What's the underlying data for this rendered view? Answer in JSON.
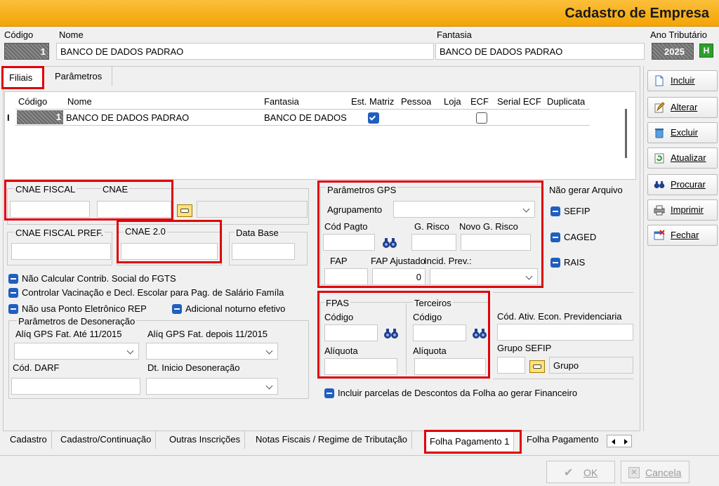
{
  "window": {
    "title": "Cadastro de Empresa"
  },
  "header": {
    "codigo_label": "Código",
    "codigo_value": "1",
    "nome_label": "Nome",
    "nome_value": "BANCO DE DADOS PADRAO",
    "fantasia_label": "Fantasia",
    "fantasia_value": "BANCO DE DADOS PADRAO",
    "ano_label": "Ano Tributário",
    "ano_value": "2025",
    "ano_btn": "H"
  },
  "tabs_top": [
    "Filiais",
    "Parâmetros"
  ],
  "grid": {
    "columns": [
      "Código",
      "Nome",
      "Fantasia",
      "Est. Matriz",
      "Pessoa",
      "Loja",
      "ECF",
      "Serial ECF",
      "Duplicata"
    ],
    "row": {
      "indicator": "I",
      "codigo": "1",
      "nome": "BANCO DE DADOS PADRAO",
      "fantasia": "BANCO DE DADOS PADRAO",
      "est_matriz": true,
      "ecf": false
    }
  },
  "side_buttons": [
    {
      "label": "Incluir",
      "icon": "new-doc-icon"
    },
    {
      "label": "Alterar",
      "icon": "edit-icon"
    },
    {
      "label": "Excluir",
      "icon": "trash-icon"
    },
    {
      "label": "Atualizar",
      "icon": "refresh-icon"
    },
    {
      "label": "Procurar",
      "icon": "binoculars-icon"
    },
    {
      "label": "Imprimir",
      "icon": "printer-icon"
    },
    {
      "label": "Fechar",
      "icon": "close-window-icon"
    }
  ],
  "form": {
    "cnae_fiscal": "CNAE FISCAL",
    "cnae": "CNAE",
    "cnae_fiscal_pref": "CNAE FISCAL PREF.",
    "cnae20": "CNAE 2.0",
    "data_base": "Data Base",
    "chk_fgts": "Não Calcular Contrib. Social do FGTS",
    "chk_vacinacao": "Controlar Vacinação e Decl. Escolar para Pag. de Salário Famíla",
    "chk_ponto": "Não usa Ponto Eletrônico REP",
    "chk_noturno": "Adicional noturno efetivo",
    "desoneracao": {
      "title": "Parâmetros de Desoneração",
      "aliq_ate": "Alíq GPS Fat. Até 11/2015",
      "aliq_depois": "Alíq GPS Fat. depois 11/2015",
      "cod_darf": "Cód. DARF",
      "dt_inicio": "Dt. Inicio Desoneração"
    },
    "gps": {
      "title": "Parâmetros GPS",
      "agrupamento": "Agrupamento",
      "cod_pagto": "Cód Pagto",
      "g_risco": "G. Risco",
      "novo_g_risco": "Novo G. Risco",
      "fap": "FAP",
      "fap_ajustado": "FAP Ajustado",
      "fap_ajustado_value": "0",
      "incid_prev": "Incid. Prev.:"
    },
    "nao_gerar": {
      "title": "Não gerar Arquivo",
      "sefip": "SEFIP",
      "caged": "CAGED",
      "rais": "RAIS"
    },
    "fpas": {
      "title": "FPAS",
      "codigo": "Código",
      "aliquota": "Alíquota"
    },
    "terceiros": {
      "title": "Terceiros",
      "codigo": "Código",
      "aliquota": "Alíquota"
    },
    "cod_ativ": "Cód. Ativ. Econ. Previdenciaria",
    "grupo_sefip": "Grupo SEFIP",
    "grupo_placeholder": "Grupo",
    "chk_parcelas": "Incluir parcelas de Descontos da Folha ao gerar Financeiro"
  },
  "tabs_bottom": [
    "Cadastro",
    "Cadastro/Continuação",
    "Outras Inscrições",
    "Notas Fiscais / Regime de Tributação",
    "Folha Pagamento 1",
    "Folha Pagamento"
  ],
  "footer": {
    "ok": "OK",
    "cancela": "Cancela"
  }
}
